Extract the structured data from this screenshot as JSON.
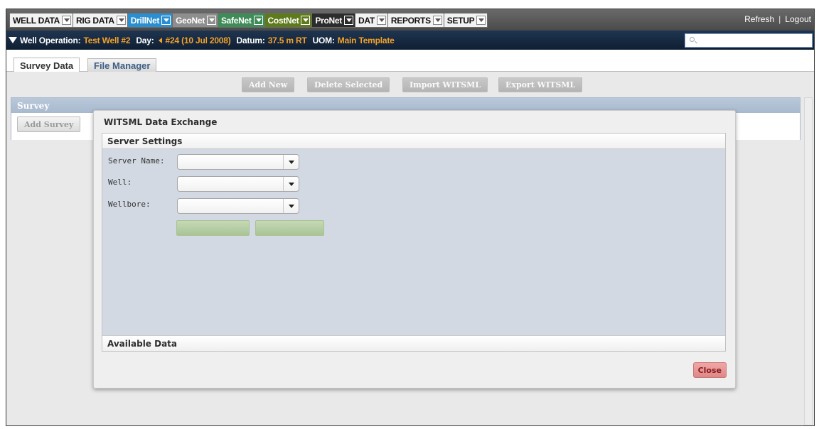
{
  "menu": {
    "items": [
      {
        "label": "WELL DATA",
        "style": "light"
      },
      {
        "label": "RIG DATA",
        "style": "light"
      },
      {
        "label": "DrillNet",
        "style": "drill"
      },
      {
        "label": "GeoNet",
        "style": "geo"
      },
      {
        "label": "SafeNet",
        "style": "safe"
      },
      {
        "label": "CostNet",
        "style": "cost"
      },
      {
        "label": "ProNet",
        "style": "pro"
      },
      {
        "label": "DAT",
        "style": "light"
      },
      {
        "label": "REPORTS",
        "style": "light"
      },
      {
        "label": "SETUP",
        "style": "light"
      }
    ],
    "refresh_label": "Refresh",
    "separator": "|",
    "logout_label": "Logout"
  },
  "operation": {
    "well_label": "Well Operation:",
    "well_value": "Test Well #2",
    "day_label": "Day:",
    "day_value": "#24 (10 Jul 2008)",
    "datum_label": "Datum:",
    "datum_value": "37.5 m RT",
    "uom_label": "UOM:",
    "uom_value": "Main Template",
    "search_value": ""
  },
  "tabs": [
    {
      "label": "Survey Data",
      "active": true
    },
    {
      "label": "File Manager",
      "active": false
    }
  ],
  "toolbar": {
    "add_new": "Add New",
    "delete_selected": "Delete Selected",
    "import_witsml": "Import WITSML",
    "export_witsml": "Export WITSML"
  },
  "survey": {
    "title": "Survey",
    "add_survey": "Add Survey"
  },
  "modal": {
    "title": "WITSML Data Exchange",
    "server_settings": "Server Settings",
    "server_name_label": "Server Name:",
    "well_label": "Well:",
    "wellbore_label": "Wellbore:",
    "server_name_value": "",
    "well_value": "",
    "wellbore_value": "",
    "available_data": "Available Data",
    "close_label": "Close"
  },
  "colors": {
    "accent_orange": "#f4a22b",
    "drillnet_blue": "#2a8fd0",
    "safenet_green": "#3e8c57",
    "costnet_olive": "#5e7a1a",
    "close_red": "#dd8888"
  }
}
